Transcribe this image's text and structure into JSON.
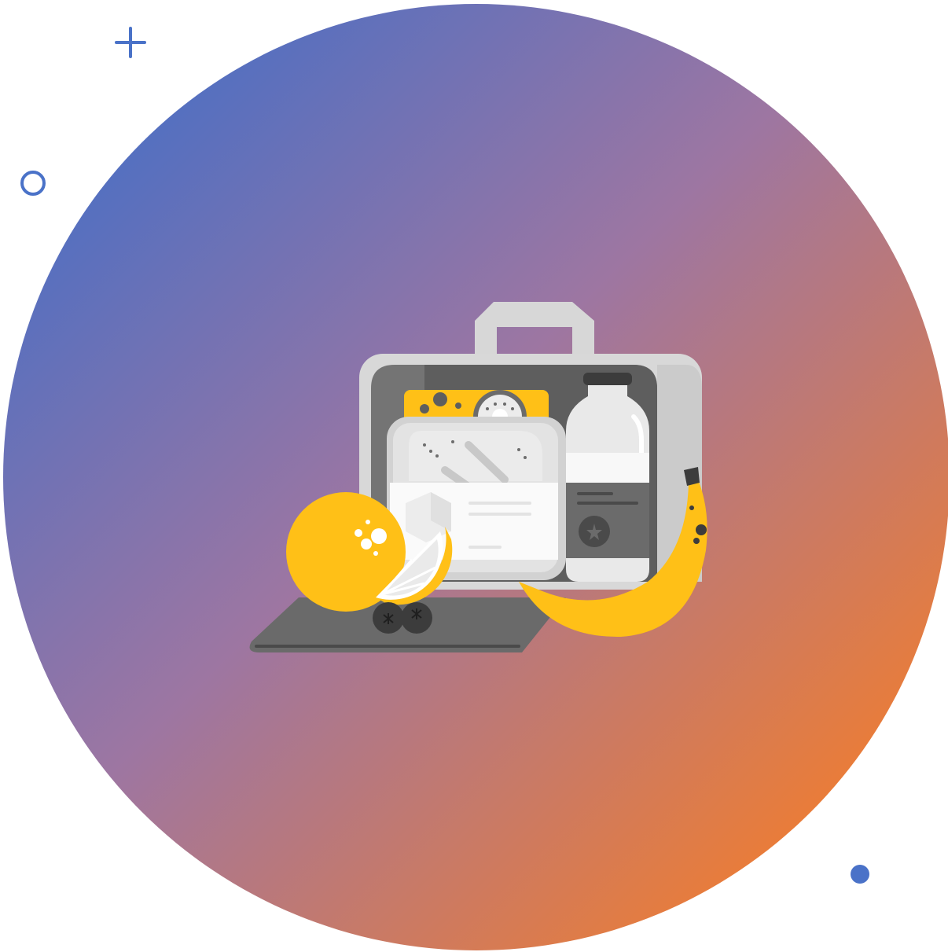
{
  "colors": {
    "gradient_start": "#4f6fc2",
    "gradient_mid": "#9b77a6",
    "gradient_end": "#e97f3a",
    "accent_blue": "#4a72c8",
    "food_yellow": "#ffc017",
    "box_light": "#d9d9d9",
    "box_dark": "#5c5c5c",
    "white": "#ffffff"
  },
  "illustration": {
    "subject": "lunch-box-illustration",
    "items": [
      "lunch-box",
      "sandwich-container",
      "cheese-slice",
      "kiwi-slice",
      "milk-bottle",
      "orange",
      "lemon-slice",
      "banana",
      "blueberries",
      "tray"
    ]
  },
  "decorations": [
    "plus-icon",
    "ring-icon",
    "dot-icon"
  ]
}
